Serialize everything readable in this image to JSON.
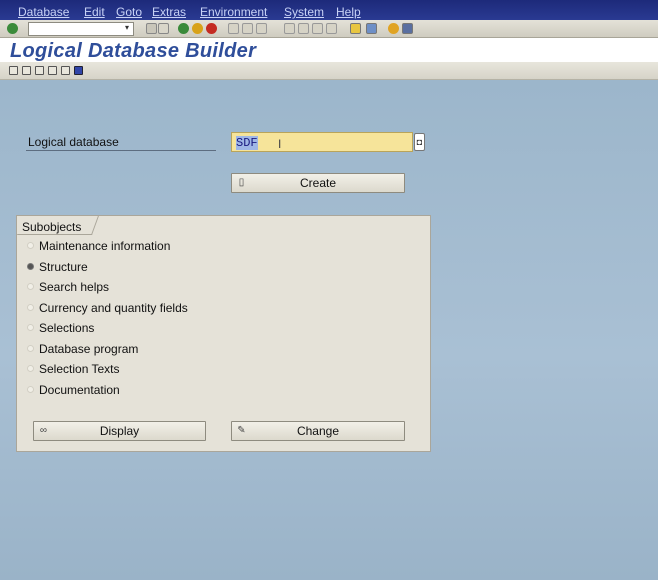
{
  "menu": [
    "Database",
    "Edit",
    "Goto",
    "Extras",
    "Environment",
    "System",
    "Help"
  ],
  "title": "Logical Database Builder",
  "form": {
    "label": "Logical database",
    "value": "SDF"
  },
  "create_button": "Create",
  "subobjects": {
    "title": "Subobjects",
    "options": [
      {
        "label": "Maintenance information",
        "selected": false
      },
      {
        "label": "Structure",
        "selected": true
      },
      {
        "label": "Search helps",
        "selected": false
      },
      {
        "label": "Currency and quantity fields",
        "selected": false
      },
      {
        "label": "Selections",
        "selected": false
      },
      {
        "label": "Database program",
        "selected": false
      },
      {
        "label": "Selection Texts",
        "selected": false
      },
      {
        "label": "Documentation",
        "selected": false
      }
    ],
    "display_button": "Display",
    "change_button": "Change"
  },
  "icons": {
    "check": "check-icon",
    "possible_entries": "possible-entries-icon",
    "create": "new-document-icon",
    "display": "glasses-icon",
    "change": "pencil-icon"
  },
  "colors": {
    "menubar": "#1d2a7a",
    "title": "#2f4e9a",
    "background": "#9eb7cc",
    "input": "#f6e49a"
  }
}
